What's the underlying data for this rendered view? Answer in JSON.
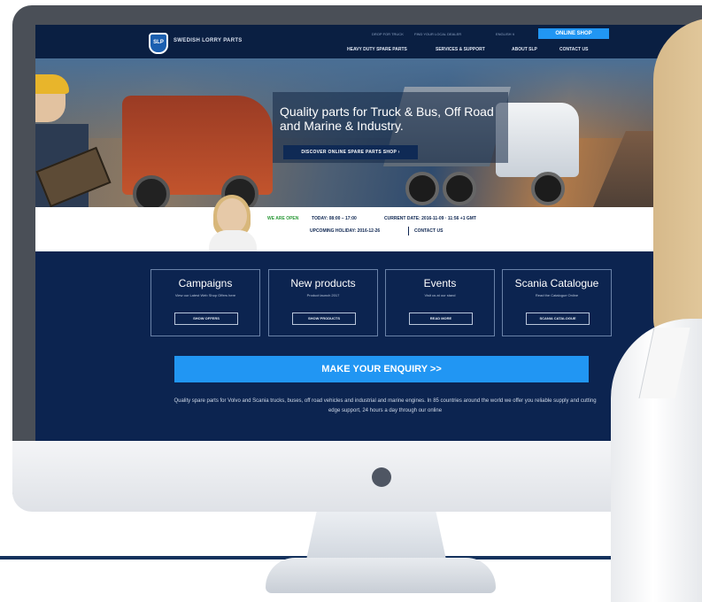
{
  "header": {
    "brand": "SWEDISH LORRY PARTS",
    "logo_text": "SLP",
    "util_links": [
      "DROP FOR TRUCK",
      "FIND YOUR LOCAL DEALER",
      "ENGLISH ∨"
    ],
    "shop_label": "ONLINE SHOP",
    "nav": [
      "HEAVY DUTY SPARE PARTS",
      "SERVICES & SUPPORT",
      "ABOUT SLP",
      "CONTACT US"
    ]
  },
  "hero": {
    "title": "Quality parts for Truck & Bus, Off Road and Marine & Industry.",
    "cta": "DISCOVER ONLINE SPARE PARTS SHOP ›"
  },
  "infobar": {
    "open": "WE ARE OPEN",
    "today": "TODAY: 08:00 – 17:00",
    "current_date": "CURRENT DATE: 2016-11-09 · 11:56 +1 GMT",
    "upcoming": "UPCOMING HOLIDAY: 2016-12-26",
    "contact": "CONTACT US"
  },
  "cards": [
    {
      "title": "Campaigns",
      "sub": "View our Latest Web Shop Offers here",
      "button": "SHOW OFFERS"
    },
    {
      "title": "New products",
      "sub": "Product launch 2017",
      "button": "SHOW PRODUCTS"
    },
    {
      "title": "Events",
      "sub": "Visit us at our stand",
      "button": "READ MORE"
    },
    {
      "title": "Scania Catalogue",
      "sub": "Read the Catalogue Online",
      "button": "SCANIA CATALOGUE"
    }
  ],
  "enquiry_label": "MAKE YOUR ENQUIRY >>",
  "description": "Quality spare parts for Volvo and Scania trucks, buses, off road vehicles and industrial and marine engines. In 85 countries around the world we offer you reliable supply and cutting edge support, 24 hours a day through our online"
}
